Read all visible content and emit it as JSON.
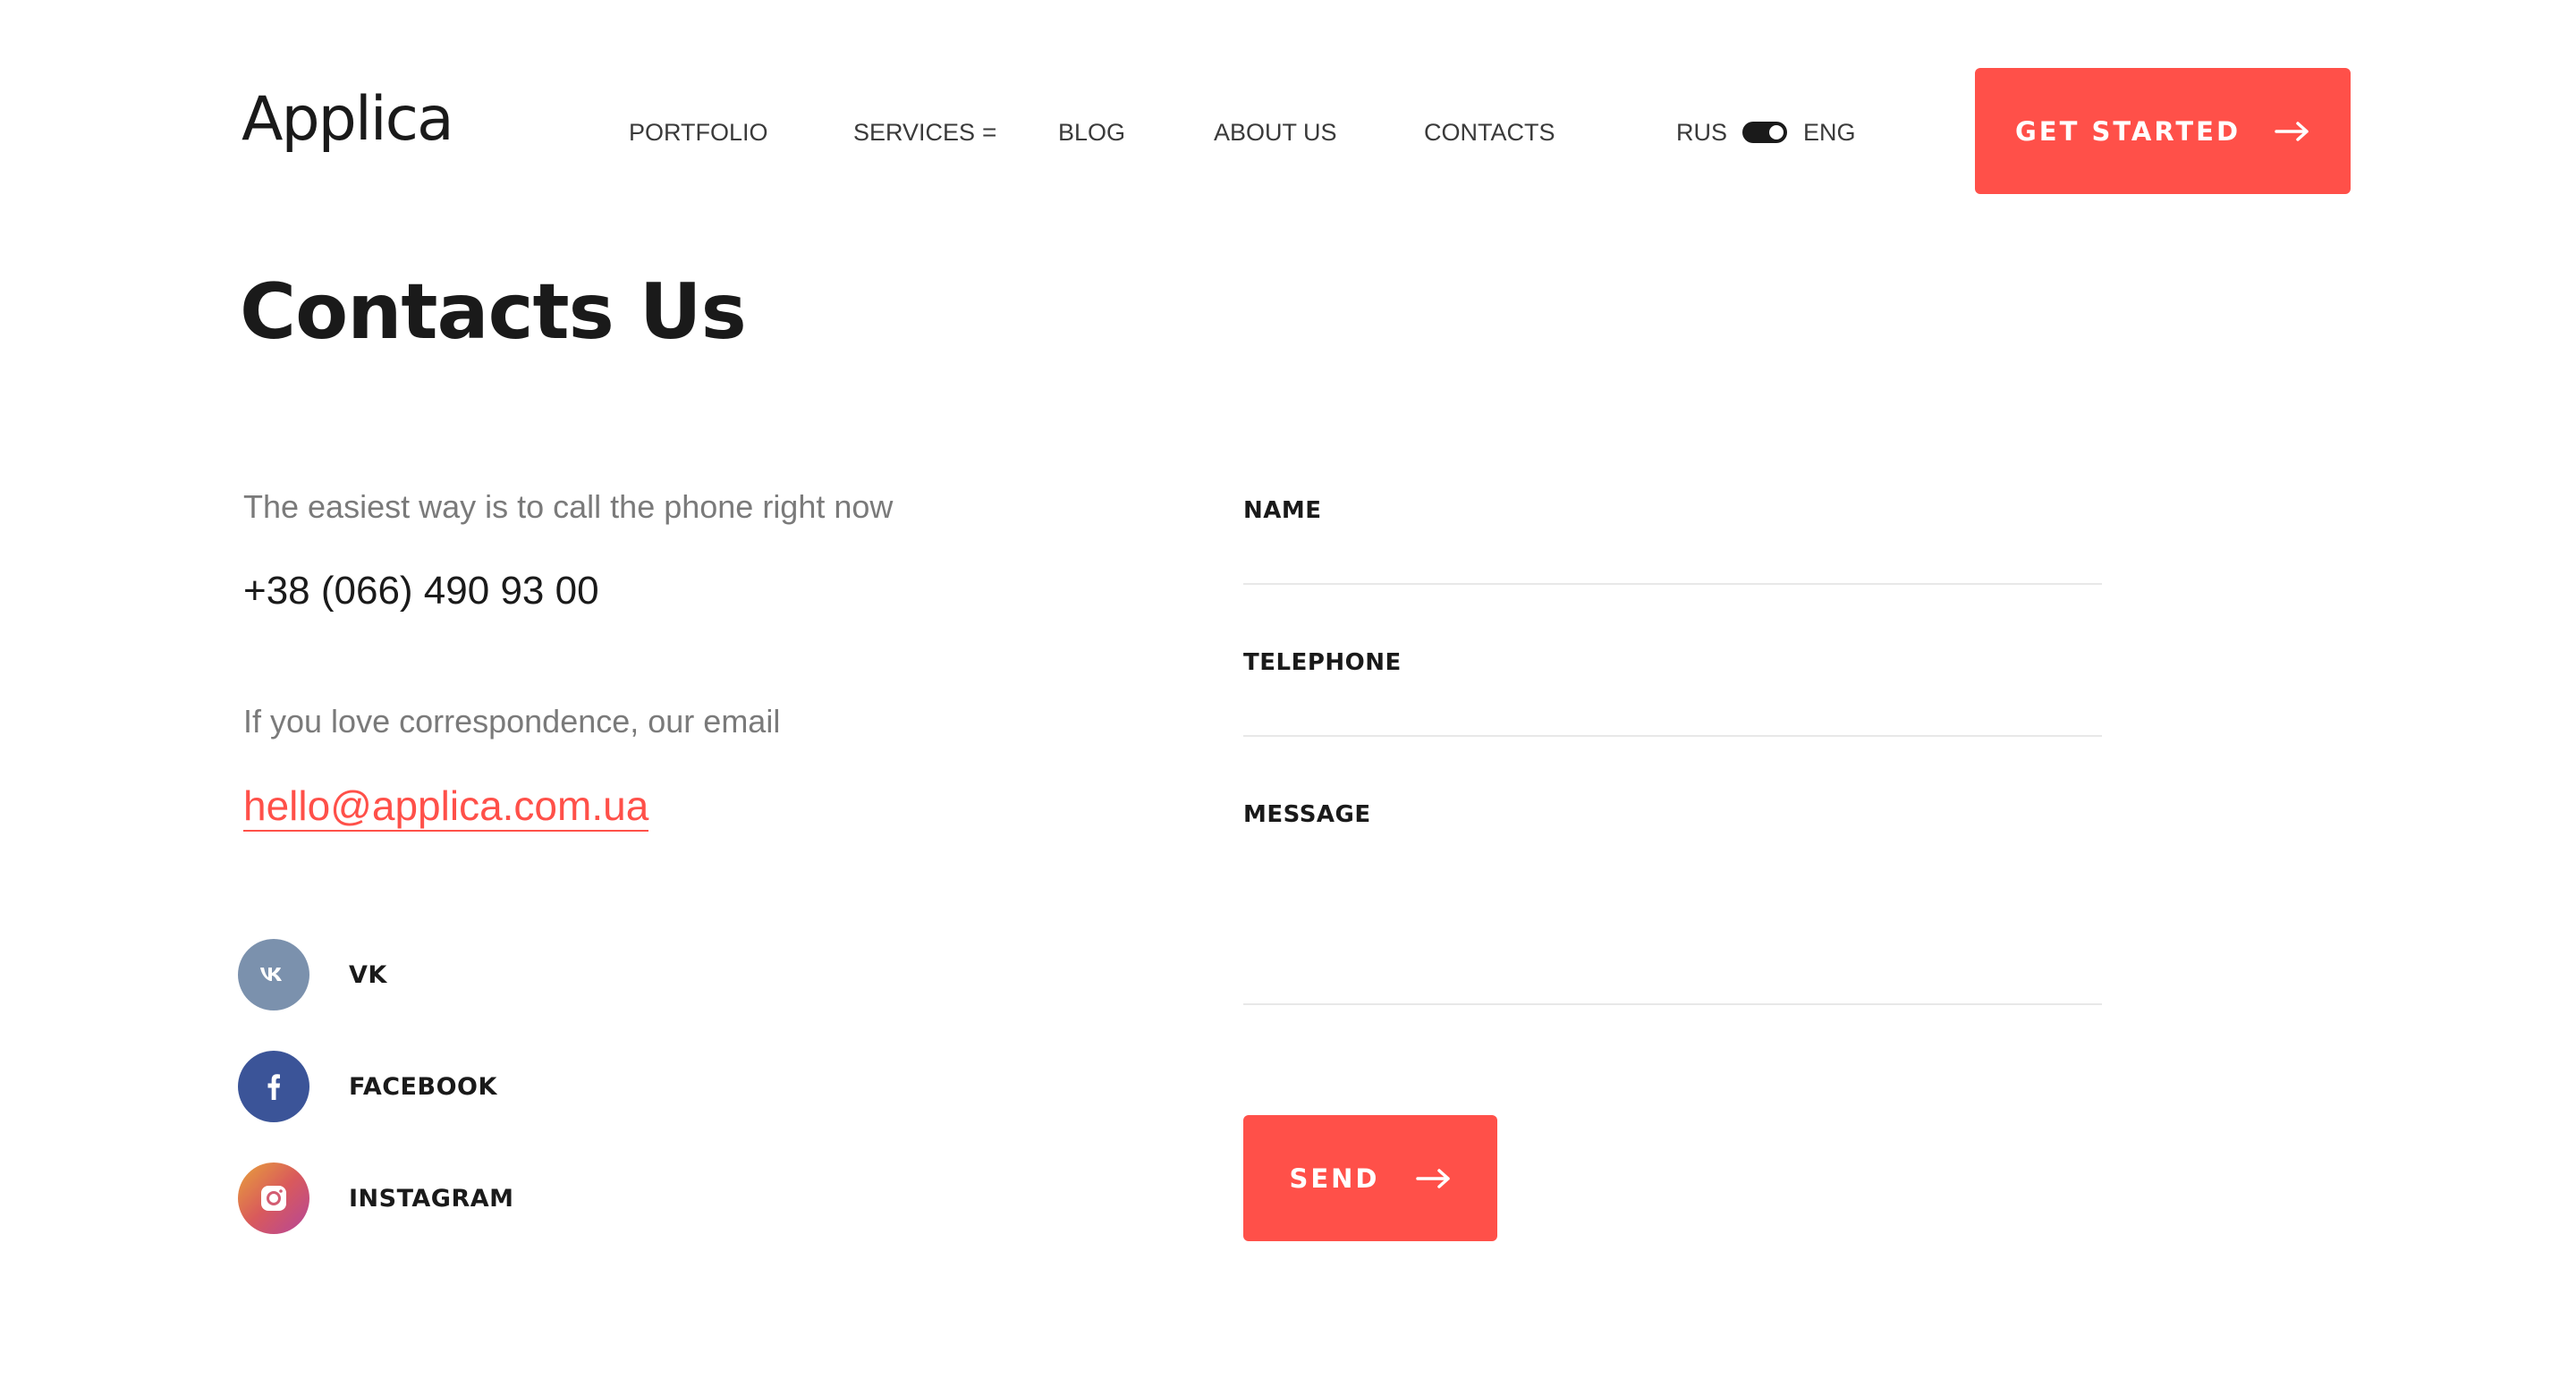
{
  "header": {
    "logo_text": "Applica",
    "nav": {
      "portfolio": "PORTFOLIO",
      "services": "SERVICES",
      "services_menu_icon": "=",
      "blog": "BLOG",
      "about": "ABOUT US",
      "contacts": "CONTACTS"
    },
    "lang": {
      "left": "RUS",
      "right": "ENG",
      "active": "ENG"
    },
    "cta_label": "GET STARTED"
  },
  "main": {
    "title": "Contacts Us",
    "phone_intro": "The easiest way is to call the phone right now",
    "phone": "+38 (066) 490 93 00",
    "email_intro": "If you love correspondence, our email",
    "email": "hello@applica.com.ua",
    "social": [
      {
        "label": "VK",
        "icon": "vk-icon",
        "color": "#7b91ad"
      },
      {
        "label": "FACEBOOK",
        "icon": "facebook-icon",
        "color": "#3b5498"
      },
      {
        "label": "INSTAGRAM",
        "icon": "instagram-icon",
        "color": "#d95a5b"
      }
    ]
  },
  "form": {
    "name_label": "NAME",
    "name_value": "",
    "telephone_label": "TELEPHONE",
    "telephone_value": "",
    "message_label": "MESSAGE",
    "message_value": "",
    "send_label": "SEND"
  },
  "colors": {
    "accent": "#ff5049",
    "text": "#1a1a1a",
    "muted": "#7a7a7a"
  }
}
